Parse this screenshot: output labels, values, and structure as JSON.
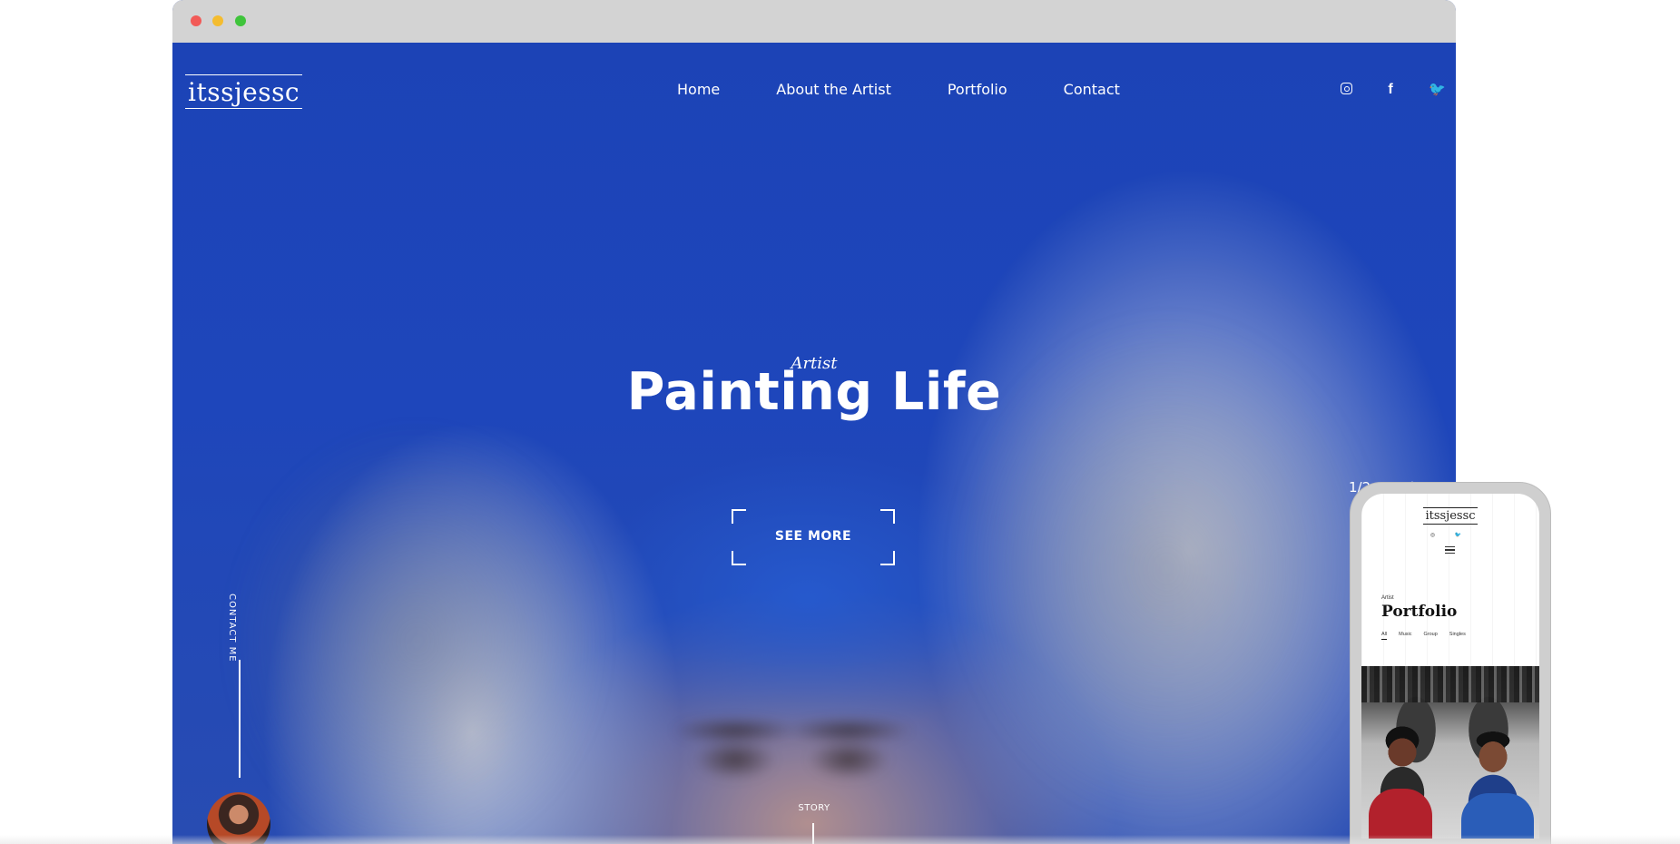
{
  "site": {
    "logo": "itssjessc"
  },
  "nav": {
    "items": [
      "Home",
      "About the Artist",
      "Portfolio",
      "Contact"
    ]
  },
  "social": {
    "icons": [
      "instagram-icon",
      "facebook-icon",
      "twitter-icon"
    ],
    "facebook_glyph": "f",
    "twitter_glyph": "🐦"
  },
  "hero": {
    "eyebrow": "Artist",
    "title": "Painting Life",
    "cta_label": "SEE MORE",
    "pager": "1/2",
    "contact_label": "CONTACT ME",
    "story_label": "STORY"
  },
  "phone": {
    "logo": "itssjessc",
    "social_glyphs": "◎ 🐦",
    "eyebrow": "Artist",
    "title": "Portfolio",
    "tabs": [
      "All",
      "Music",
      "Group",
      "Singles"
    ]
  },
  "colors": {
    "hero_blue": "#1f44b0",
    "window_bar": "#d3d3d3",
    "close": "#f25a57",
    "minimize": "#f4bc2f",
    "maximize": "#3fc43b"
  }
}
